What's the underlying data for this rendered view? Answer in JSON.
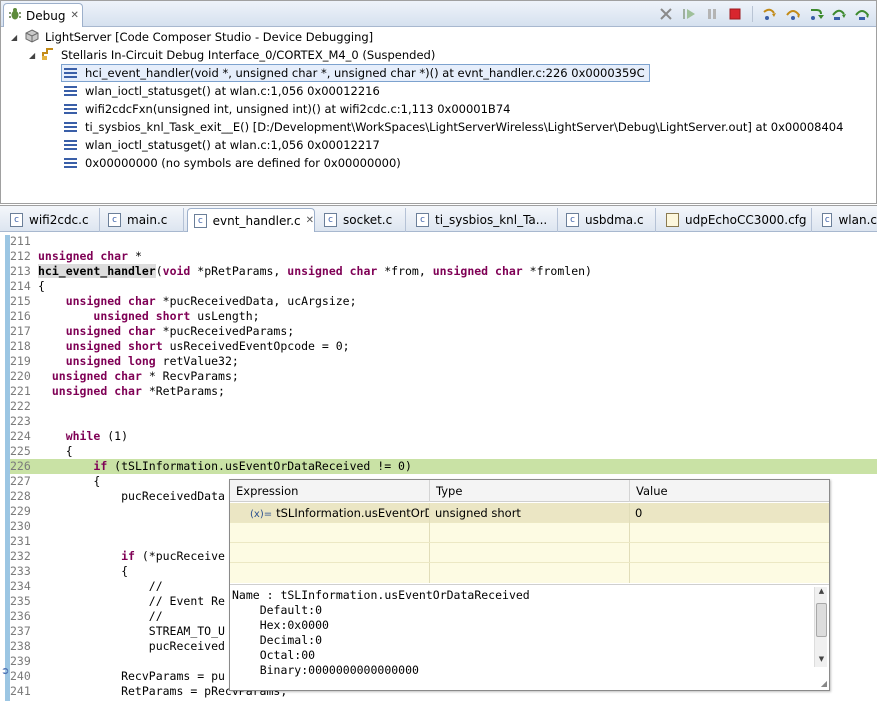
{
  "debug_view": {
    "tab_label": "Debug",
    "toolbar_icons": [
      "remove-all-terminated-icon",
      "resume-icon",
      "suspend-icon",
      "terminate-icon",
      "step-into-icon",
      "step-over-icon",
      "step-return-icon",
      "assembly-step-into-icon",
      "assembly-step-over-icon"
    ],
    "tree": {
      "session": "LightServer [Code Composer Studio - Device Debugging]",
      "target": "Stellaris In-Circuit Debug Interface_0/CORTEX_M4_0 (Suspended)",
      "frames": [
        "hci_event_handler(void *, unsigned char *, unsigned char *)() at evnt_handler.c:226 0x0000359C",
        "wlan_ioctl_statusget() at wlan.c:1,056 0x00012216",
        "wifi2cdcFxn(unsigned int, unsigned int)() at wifi2cdc.c:1,113 0x00001B74",
        "ti_sysbios_knl_Task_exit__E() [D:/Development\\WorkSpaces\\LightServerWireless\\LightServer\\Debug\\LightServer.out] at 0x00008404",
        "wlan_ioctl_statusget() at wlan.c:1,056 0x00012217",
        "0x00000000  (no symbols are defined for 0x00000000)"
      ]
    }
  },
  "editor": {
    "tabs": [
      {
        "label": "wifi2cdc.c"
      },
      {
        "label": "main.c"
      },
      {
        "label": "evnt_handler.c"
      },
      {
        "label": "socket.c"
      },
      {
        "label": "ti_sysbios_knl_Ta..."
      },
      {
        "label": "usbdma.c"
      },
      {
        "label": "udpEchoCC3000.cfg"
      },
      {
        "label": "wlan.c"
      }
    ],
    "lines": [
      {
        "n": "211",
        "t": ""
      },
      {
        "n": "212",
        "t": "unsigned char *"
      },
      {
        "n": "213",
        "t": "hci_event_handler(void *pRetParams, unsigned char *from, unsigned char *fromlen)"
      },
      {
        "n": "214",
        "t": "{"
      },
      {
        "n": "215",
        "t": "    unsigned char *pucReceivedData, ucArgsize;"
      },
      {
        "n": "216",
        "t": "        unsigned short usLength;"
      },
      {
        "n": "217",
        "t": "    unsigned char *pucReceivedParams;"
      },
      {
        "n": "218",
        "t": "    unsigned short usReceivedEventOpcode = 0;"
      },
      {
        "n": "219",
        "t": "    unsigned long retValue32;"
      },
      {
        "n": "220",
        "t": "  unsigned char * RecvParams;"
      },
      {
        "n": "221",
        "t": "  unsigned char *RetParams;"
      },
      {
        "n": "222",
        "t": ""
      },
      {
        "n": "223",
        "t": ""
      },
      {
        "n": "224",
        "t": "    while (1)"
      },
      {
        "n": "225",
        "t": "    {"
      },
      {
        "n": "226",
        "t": "        if (tSLInformation.usEventOrDataReceived != 0)"
      },
      {
        "n": "227",
        "t": "        {"
      },
      {
        "n": "228",
        "t": "            pucReceivedData"
      },
      {
        "n": "229",
        "t": ""
      },
      {
        "n": "230",
        "t": ""
      },
      {
        "n": "231",
        "t": ""
      },
      {
        "n": "232",
        "t": "            if (*pucReceive"
      },
      {
        "n": "233",
        "t": "            {"
      },
      {
        "n": "234",
        "t": "                //"
      },
      {
        "n": "235",
        "t": "                // Event Re"
      },
      {
        "n": "236",
        "t": "                //"
      },
      {
        "n": "237",
        "t": "                STREAM_TO_U"
      },
      {
        "n": "238",
        "t": "                pucReceived"
      },
      {
        "n": "239",
        "t": ""
      },
      {
        "n": "240",
        "t": "            RecvParams = pu"
      },
      {
        "n": "241",
        "t": "            RetParams = pRecvParams;"
      }
    ]
  },
  "hover_popup": {
    "columns": [
      "Expression",
      "Type",
      "Value"
    ],
    "row": {
      "expression": "tSLInformation.usEventOrDataReceived",
      "type": "unsigned short",
      "value": "0",
      "icon": "(x)="
    },
    "details": [
      "Name : tSLInformation.usEventOrDataReceived",
      "    Default:0",
      "    Hex:0x0000",
      "    Decimal:0",
      "    Octal:00",
      "    Binary:0000000000000000"
    ]
  },
  "colors": {
    "current_line": "#c9e2a5",
    "keyword": "#7f0055",
    "popup_bg": "#fdfbe3"
  }
}
